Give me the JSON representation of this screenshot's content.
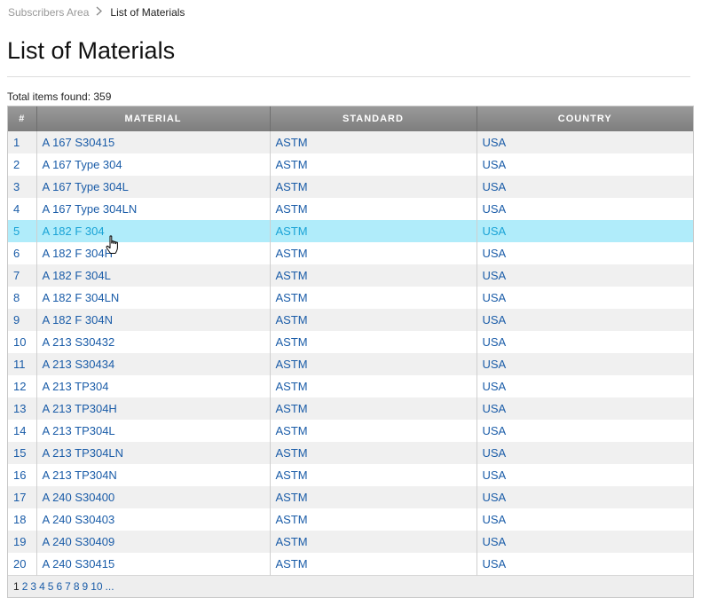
{
  "breadcrumb": {
    "parent": "Subscribers Area",
    "separator": ">",
    "current": "List of Materials"
  },
  "page_title": "List of Materials",
  "total_label": "Total items found: 359",
  "table": {
    "headers": [
      "#",
      "MATERIAL",
      "STANDARD",
      "COUNTRY"
    ],
    "rows": [
      {
        "num": "1",
        "material": "A 167 S30415",
        "standard": "ASTM",
        "country": "USA"
      },
      {
        "num": "2",
        "material": "A 167 Type 304",
        "standard": "ASTM",
        "country": "USA"
      },
      {
        "num": "3",
        "material": "A 167 Type 304L",
        "standard": "ASTM",
        "country": "USA"
      },
      {
        "num": "4",
        "material": "A 167 Type 304LN",
        "standard": "ASTM",
        "country": "USA"
      },
      {
        "num": "5",
        "material": "A 182 F 304",
        "standard": "ASTM",
        "country": "USA"
      },
      {
        "num": "6",
        "material": "A 182 F 304H",
        "standard": "ASTM",
        "country": "USA"
      },
      {
        "num": "7",
        "material": "A 182 F 304L",
        "standard": "ASTM",
        "country": "USA"
      },
      {
        "num": "8",
        "material": "A 182 F 304LN",
        "standard": "ASTM",
        "country": "USA"
      },
      {
        "num": "9",
        "material": "A 182 F 304N",
        "standard": "ASTM",
        "country": "USA"
      },
      {
        "num": "10",
        "material": "A 213 S30432",
        "standard": "ASTM",
        "country": "USA"
      },
      {
        "num": "11",
        "material": "A 213 S30434",
        "standard": "ASTM",
        "country": "USA"
      },
      {
        "num": "12",
        "material": "A 213 TP304",
        "standard": "ASTM",
        "country": "USA"
      },
      {
        "num": "13",
        "material": "A 213 TP304H",
        "standard": "ASTM",
        "country": "USA"
      },
      {
        "num": "14",
        "material": "A 213 TP304L",
        "standard": "ASTM",
        "country": "USA"
      },
      {
        "num": "15",
        "material": "A 213 TP304LN",
        "standard": "ASTM",
        "country": "USA"
      },
      {
        "num": "16",
        "material": "A 213 TP304N",
        "standard": "ASTM",
        "country": "USA"
      },
      {
        "num": "17",
        "material": "A 240 S30400",
        "standard": "ASTM",
        "country": "USA"
      },
      {
        "num": "18",
        "material": "A 240 S30403",
        "standard": "ASTM",
        "country": "USA"
      },
      {
        "num": "19",
        "material": "A 240 S30409",
        "standard": "ASTM",
        "country": "USA"
      },
      {
        "num": "20",
        "material": "A 240 S30415",
        "standard": "ASTM",
        "country": "USA"
      }
    ],
    "hovered_row": "5"
  },
  "pager": {
    "current": "1",
    "pages": [
      "2",
      "3",
      "4",
      "5",
      "6",
      "7",
      "8",
      "9",
      "10"
    ],
    "more": "..."
  },
  "colors": {
    "link": "#1a5ca8",
    "hover_row": "#b0ecfa",
    "header_bg": "#8a8a8a",
    "odd_row": "#f0f0f0"
  },
  "icons": {
    "breadcrumb_separator": "chevron-right-icon",
    "mouse_cursor": "hand-pointer-icon"
  }
}
